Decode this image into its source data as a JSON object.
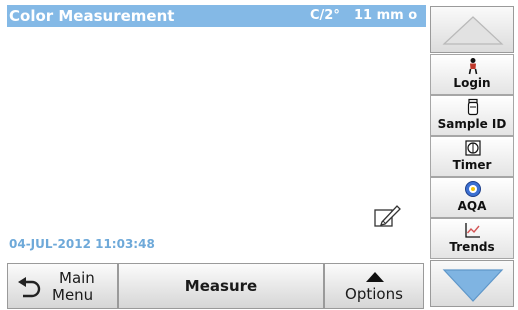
{
  "header": {
    "title": "Color Measurement",
    "observer": "C/2°",
    "cell": "11 mm o"
  },
  "main": {
    "timestamp": "04-JUL-2012  11:03:48"
  },
  "bottom_bar": {
    "main_menu_line1": "Main",
    "main_menu_line2": "Menu",
    "measure_label": "Measure",
    "options_label": "Options"
  },
  "side_menu": {
    "items": [
      {
        "label": "Login",
        "icon": "person-icon"
      },
      {
        "label": "Sample ID",
        "icon": "sample-bottle-icon"
      },
      {
        "label": "Timer",
        "icon": "timer-icon"
      },
      {
        "label": "AQA",
        "icon": "aqa-icon"
      },
      {
        "label": "Trends",
        "icon": "trends-chart-icon"
      }
    ]
  },
  "colors": {
    "title_bar": "#84b9e6",
    "timestamp": "#6ea9d9",
    "scroll_arrow": "#7fb4e2"
  }
}
